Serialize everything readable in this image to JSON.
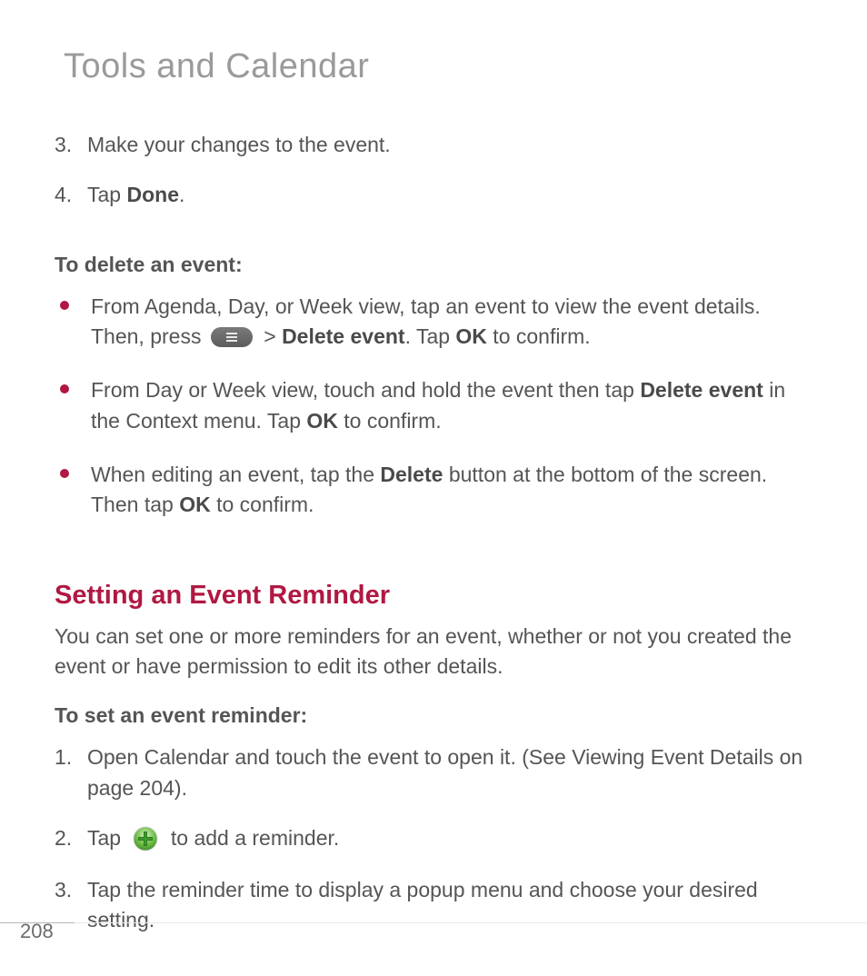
{
  "chapter_title": "Tools and Calendar",
  "page_number": "208",
  "steps_continued": [
    {
      "number": "3",
      "html": "Make your changes to the event."
    },
    {
      "number": "4",
      "html": "Tap <strong>Done</strong>."
    }
  ],
  "delete_heading": "To delete an event:",
  "delete_bullets": [
    "From Agenda, Day, or Week view, tap an event to view the event details. Then, press {MENU_ICON} > <strong>Delete event</strong>. Tap <strong>OK</strong> to confirm.",
    "From Day or Week view, touch and hold the event then tap <strong>Delete event</strong> in the Context menu. Tap <strong>OK</strong> to confirm.",
    "When editing an event, tap the <strong>Delete</strong> button at the bottom of the screen. Then tap <strong>OK</strong> to confirm."
  ],
  "reminder_section_title": "Setting an Event Reminder",
  "reminder_intro": "You can set one or more reminders for an event, whether or not you created the event or have permission to edit its other details.",
  "reminder_set_heading": "To set an event reminder:",
  "reminder_steps": [
    "Open Calendar and touch the event to open it. (See Viewing Event Details on page 204).",
    "Tap {PLUS_ICON} to add a reminder.",
    "Tap the reminder time to display a popup menu and choose your desired setting."
  ]
}
